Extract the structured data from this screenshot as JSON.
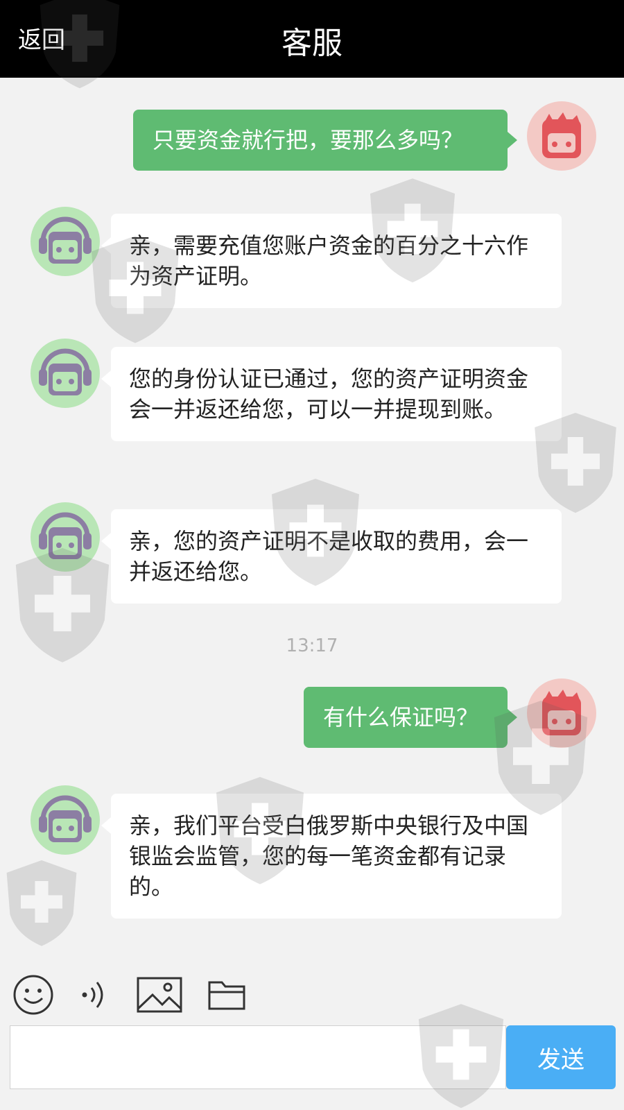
{
  "header": {
    "back_label": "返回",
    "title": "客服"
  },
  "messages": [
    {
      "side": "out",
      "text": "只要资金就行把，要那么多吗？"
    },
    {
      "side": "in",
      "text": "亲，需要充值您账户资金的百分之十六作为资产证明。"
    },
    {
      "side": "in",
      "text": "您的身份认证已通过，您的资产证明资金会一并返还给您，可以一并提现到账。"
    },
    {
      "side": "in",
      "text": "亲，您的资产证明不是收取的费用，会一并返还给您。"
    },
    {
      "timestamp": "13:17"
    },
    {
      "side": "out",
      "text": "有什么保证吗？"
    },
    {
      "side": "in",
      "text": "亲，我们平台受白俄罗斯中央银行及中国银监会监管，您的每一笔资金都有记录的。"
    }
  ],
  "toolbar": {
    "icons": [
      "emoji-icon",
      "voice-icon",
      "image-icon",
      "folder-icon"
    ]
  },
  "composer": {
    "input_value": "",
    "send_label": "发送"
  },
  "colors": {
    "header_bg": "#000000",
    "outgoing_bubble": "#5fbb72",
    "incoming_bubble": "#ffffff",
    "send_button": "#4aaef5",
    "agent_avatar_bg": "#b9e6b6",
    "user_avatar_bg": "#f3c9c5"
  }
}
